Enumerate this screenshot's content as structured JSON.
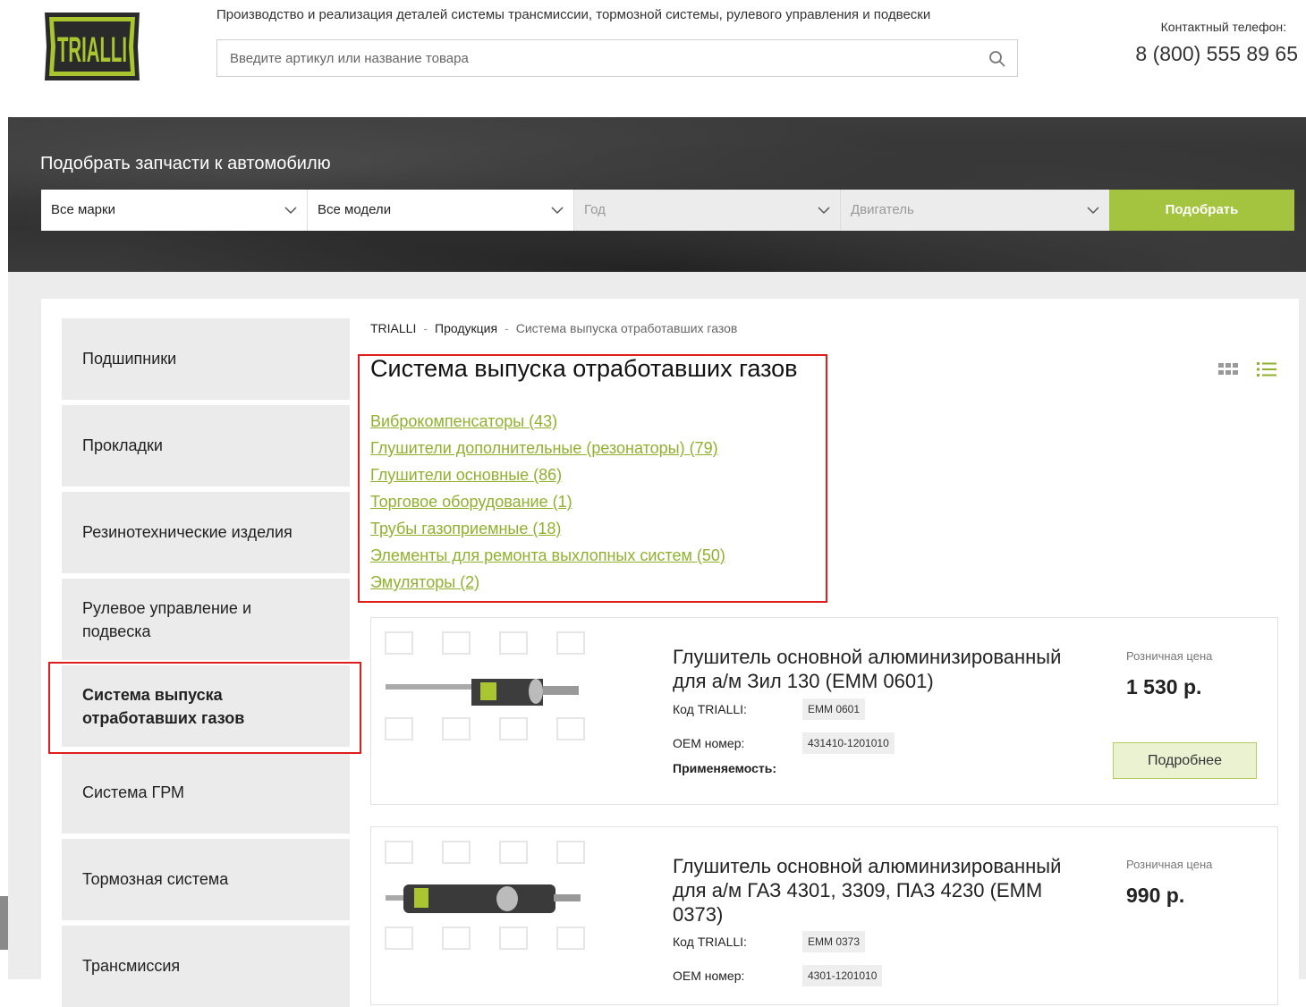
{
  "header": {
    "logo_text": "TRIALLI",
    "tagline": "Производство и реализация деталей системы трансмиссии, тормозной системы, рулевого управления и подвески",
    "search_placeholder": "Введите артикул или название товара",
    "phone_label": "Контактный телефон:",
    "phone": "8 (800) 555 89 65"
  },
  "picker": {
    "title": "Подобрать запчасти к автомобилю",
    "brand": "Все марки",
    "model": "Все модели",
    "year": "Год",
    "engine": "Двигатель",
    "submit": "Подобрать",
    "accent_color": "#a4c43f"
  },
  "sidebar": {
    "items": [
      {
        "label": "Подшипники"
      },
      {
        "label": "Прокладки"
      },
      {
        "label": "Резинотехнические изделия"
      },
      {
        "label": "Рулевое управление и подвеска"
      },
      {
        "label": "Система выпуска отработавших газов",
        "active": true
      },
      {
        "label": "Система ГРМ"
      },
      {
        "label": "Тормозная система"
      },
      {
        "label": "Трансмиссия"
      }
    ]
  },
  "breadcrumb": [
    "TRIALLI",
    "Продукция",
    "Система выпуска отработавших газов"
  ],
  "breadcrumb_sep": "-",
  "page_title": "Система выпуска отработавших газов",
  "categories": [
    "Виброкомпенсаторы (43)",
    "Глушители дополнительные (резонаторы) (79)",
    "Глушители основные (86)",
    "Торговое оборудование (1)",
    "Трубы газоприемные (18)",
    "Элементы для ремонта выхлопных систем (50)",
    "Эмуляторы (2)"
  ],
  "view_icons": [
    "grid-view-icon",
    "list-view-icon"
  ],
  "products": [
    {
      "title": "Глушитель основной алюминизированный для а/м Зил 130 (ЕММ 0601)",
      "code_label": "Код TRIALLI:",
      "code": "EMM 0601",
      "oem_label": "OEM номер:",
      "oem": "431410-1201010",
      "applic_label": "Применяемость:",
      "price_label": "Розничная цена",
      "price": "1 530 р.",
      "more": "Подробнее"
    },
    {
      "title": "Глушитель основной алюминизированный для а/м ГАЗ 4301, 3309, ПАЗ 4230 (ЕММ 0373)",
      "code_label": "Код TRIALLI:",
      "code": "EMM 0373",
      "oem_label": "OEM номер:",
      "oem": "4301-1201010",
      "price_label": "Розничная цена",
      "price": "990 р."
    }
  ],
  "highlight_color": "#e01d1d"
}
